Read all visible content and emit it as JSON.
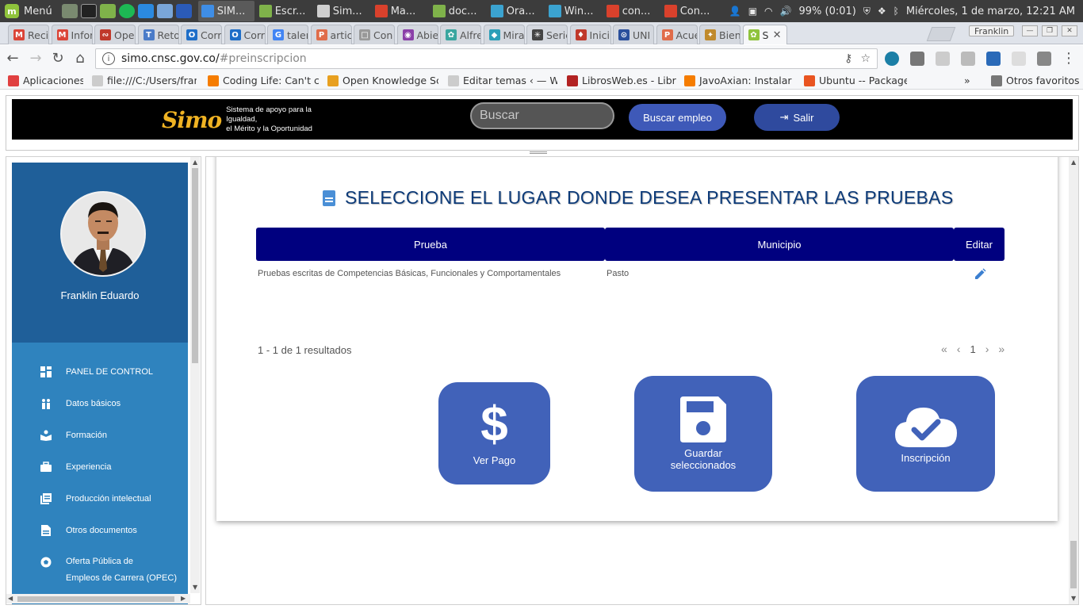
{
  "taskbar": {
    "menu_label": "Menú",
    "windows": [
      {
        "label": "SIM...",
        "color": "#3f8ee6",
        "active": true
      },
      {
        "label": "Escr...",
        "color": "#7fb24a"
      },
      {
        "label": "Sim...",
        "color": "#cfcfcf"
      },
      {
        "label": "Ma...",
        "color": "#d9412c"
      },
      {
        "label": "doc...",
        "color": "#7fb24a"
      },
      {
        "label": "Ora...",
        "color": "#3ba3d0"
      },
      {
        "label": "Win...",
        "color": "#3ba3d0"
      },
      {
        "label": "con...",
        "color": "#d9412c"
      },
      {
        "label": "Con...",
        "color": "#d9412c"
      }
    ],
    "battery": "99% (0:01)",
    "clock": "Miércoles,  1 de marzo, 12:21 AM"
  },
  "browser": {
    "tabs": [
      {
        "label": "Recil",
        "fav": "M",
        "color": "#db4437"
      },
      {
        "label": "Infor",
        "fav": "M",
        "color": "#db4437"
      },
      {
        "label": "Ope",
        "fav": "∾",
        "color": "#c0392b"
      },
      {
        "label": "Reto",
        "fav": "T",
        "color": "#4a7bc8"
      },
      {
        "label": "Corr",
        "fav": "O",
        "color": "#1e6ec8"
      },
      {
        "label": "Corr",
        "fav": "O",
        "color": "#1e6ec8"
      },
      {
        "label": "taler",
        "fav": "G",
        "color": "#4285f4"
      },
      {
        "label": "artic",
        "fav": "P",
        "color": "#e06c4a"
      },
      {
        "label": "Con",
        "fav": "□",
        "color": "#999999"
      },
      {
        "label": "Abie",
        "fav": "◉",
        "color": "#8b3fa8"
      },
      {
        "label": "Alfre",
        "fav": "✿",
        "color": "#3aa6a0"
      },
      {
        "label": "Mira",
        "fav": "◆",
        "color": "#2b9fb8"
      },
      {
        "label": "Serie",
        "fav": "✳",
        "color": "#444444"
      },
      {
        "label": "Inici",
        "fav": "♦",
        "color": "#c0392b"
      },
      {
        "label": "UNI",
        "fav": "⊙",
        "color": "#2a4f9c"
      },
      {
        "label": "Acue",
        "fav": "P",
        "color": "#e06c4a"
      },
      {
        "label": "Bien",
        "fav": "✦",
        "color": "#c08a2c"
      },
      {
        "label": "S",
        "fav": "✿",
        "color": "#8fc33c",
        "active": true
      }
    ],
    "profile_name": "Franklin",
    "url_host": "simo.cnsc.gov.co/",
    "url_path": "#preinscripcion",
    "bookmarks": [
      {
        "label": "Aplicaciones",
        "color": "#e04040"
      },
      {
        "label": "file:///C:/Users/frank",
        "color": "#cccccc"
      },
      {
        "label": "Coding Life: Can't co",
        "color": "#f57c00"
      },
      {
        "label": "Open Knowledge Scr",
        "color": "#e8a020"
      },
      {
        "label": "Editar temas ‹ — Wo",
        "color": "#cccccc"
      },
      {
        "label": "LibrosWeb.es - Libro",
        "color": "#b22222"
      },
      {
        "label": "JavoAxian: Instalar P",
        "color": "#f57c00"
      },
      {
        "label": "Ubuntu -- Package D",
        "color": "#e95420"
      }
    ],
    "bookmarks_more": "»",
    "other_bookmarks": "Otros favoritos"
  },
  "site": {
    "logo_word": "Simo",
    "logo_tagline_1": "Sistema de apoyo para la Igualdad,",
    "logo_tagline_2": "el Mérito y la Oportunidad",
    "search_placeholder": "Buscar",
    "find_job_label": "Buscar empleo",
    "logout_label": "Salir"
  },
  "sidebar": {
    "user_name": "Franklin Eduardo",
    "items": [
      {
        "label": "PANEL DE CONTROL",
        "icon": "dashboard-icon"
      },
      {
        "label": "Datos básicos",
        "icon": "people-icon"
      },
      {
        "label": "Formación",
        "icon": "book-reader-icon"
      },
      {
        "label": "Experiencia",
        "icon": "briefcase-icon"
      },
      {
        "label": "Producción intelectual",
        "icon": "library-books-icon"
      },
      {
        "label": "Otros documentos",
        "icon": "document-icon"
      },
      {
        "label": "Oferta Pública de",
        "label2": "Empleos de Carrera (OPEC)",
        "icon": "football-icon"
      }
    ]
  },
  "main": {
    "title": "SELECCIONE EL LUGAR DONDE DESEA PRESENTAR LAS PRUEBAS",
    "columns": [
      "Prueba",
      "Municipio",
      "Editar"
    ],
    "rows": [
      {
        "prueba": "Pruebas escritas de Competencias Básicas, Funcionales y Comportamentales",
        "municipio": "Pasto"
      }
    ],
    "results_text": "1 - 1 de 1 resultados",
    "current_page": "1",
    "actions": {
      "ver_pago": "Ver Pago",
      "guardar": "Guardar seleccionados",
      "inscripcion": "Inscripción"
    }
  }
}
